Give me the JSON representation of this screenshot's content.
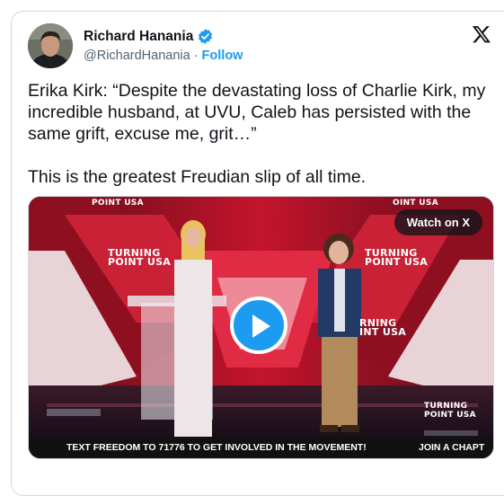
{
  "author": {
    "display_name": "Richard Hanania",
    "handle": "@RichardHanania",
    "separator": "·",
    "follow_label": "Follow",
    "verified": true
  },
  "tweet": {
    "text": "Erika Kirk: “Despite the devastating loss of Charlie Kirk, my incredible husband, at UVU, Caleb has persisted with the same grift, excuse me, grit…”\n\nThis is the greatest Freudian slip of all time."
  },
  "media": {
    "watch_label": "Watch on X",
    "ticker_main": "TEXT FREEDOM TO 71776 TO GET INVOLVED IN THE MOVEMENT!",
    "ticker_side": "JOIN A CHAPT",
    "stage_logo_top": "POINT USA",
    "stage_logo_line1": "TURNING",
    "stage_logo_line2": "POINT USA",
    "stage_logo_partial1": "RNING",
    "stage_logo_partial2": "INT USA",
    "stage_logo_partial_top": "OINT USA"
  },
  "colors": {
    "accent": "#1d9bf0",
    "text": "#0f1419",
    "secondary_text": "#536471",
    "stage_red": "#c8102e"
  },
  "icons": {
    "verified": "verified-badge-icon",
    "x_logo": "x-logo-icon",
    "play": "play-icon"
  }
}
